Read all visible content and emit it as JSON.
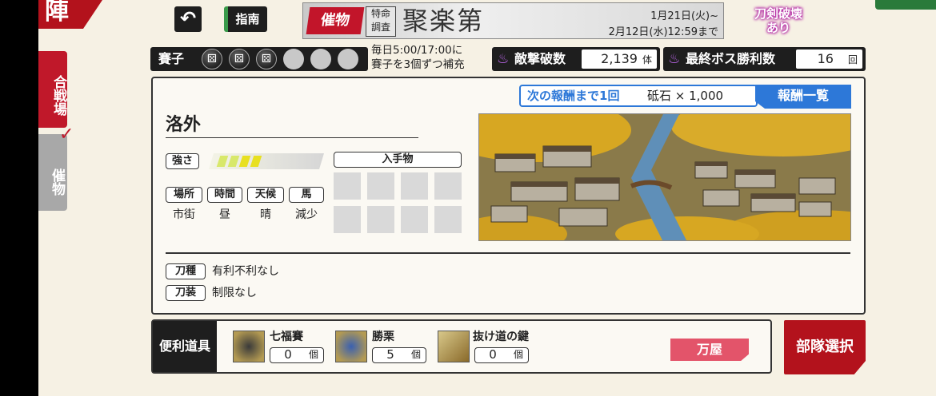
{
  "header": {
    "corner_tag": "陣",
    "back_icon": "back-arrow-icon",
    "guide_label": "指南"
  },
  "event": {
    "tag": "催物",
    "box_line1": "特命",
    "box_line2": "調査",
    "title": "聚楽第",
    "date_start": "1月21日(火)~",
    "date_end": "2月12日(水)12:59まで",
    "break_badge_line1": "刀剣破壊",
    "break_badge_line2": "あり"
  },
  "side_tabs": [
    {
      "label": "合戦場",
      "active": true
    },
    {
      "label": "催物",
      "active": false
    }
  ],
  "dice": {
    "label": "賽子",
    "filled": 3,
    "total": 6,
    "refill_line1": "毎日5:00/17:00に",
    "refill_line2": "賽子を3個ずつ補充"
  },
  "stats": {
    "enemies_label": "敵撃破数",
    "enemies_value": "2,139",
    "enemies_unit": "体",
    "boss_label": "最終ボス勝利数",
    "boss_value": "16",
    "boss_unit": "回"
  },
  "reward": {
    "next_label": "次の報酬まで1回",
    "next_item": "砥石 × 1,000",
    "list_button": "報酬一覧"
  },
  "area": {
    "name": "洛外",
    "strength_label": "強さ",
    "strength_level": 4,
    "strength_max": 7,
    "acquire_label": "入手物",
    "acquire_slots": 8,
    "info": [
      {
        "label": "場所",
        "value": "市街"
      },
      {
        "label": "時間",
        "value": "昼"
      },
      {
        "label": "天候",
        "value": "晴"
      },
      {
        "label": "馬",
        "value": "減少"
      }
    ],
    "conditions": [
      {
        "label": "刀種",
        "value": "有利不利なし"
      },
      {
        "label": "刀装",
        "value": "制限なし"
      }
    ]
  },
  "tools": {
    "label": "便利道具",
    "items": [
      {
        "name": "七福賽",
        "count": "0",
        "unit": "個",
        "icon": "dice-item-icon"
      },
      {
        "name": "勝栗",
        "count": "5",
        "unit": "個",
        "icon": "chestnut-item-icon"
      },
      {
        "name": "抜け道の鍵",
        "count": "0",
        "unit": "個",
        "icon": "key-item-icon"
      }
    ]
  },
  "buttons": {
    "yorozuya": "万屋",
    "unit_select": "部隊選択"
  },
  "colors": {
    "accent_red": "#b3121c",
    "accent_blue": "#2d78d8",
    "pink": "#e3546a",
    "strength_yellow": "#e8e020",
    "flame_purple": "#c068f0"
  }
}
